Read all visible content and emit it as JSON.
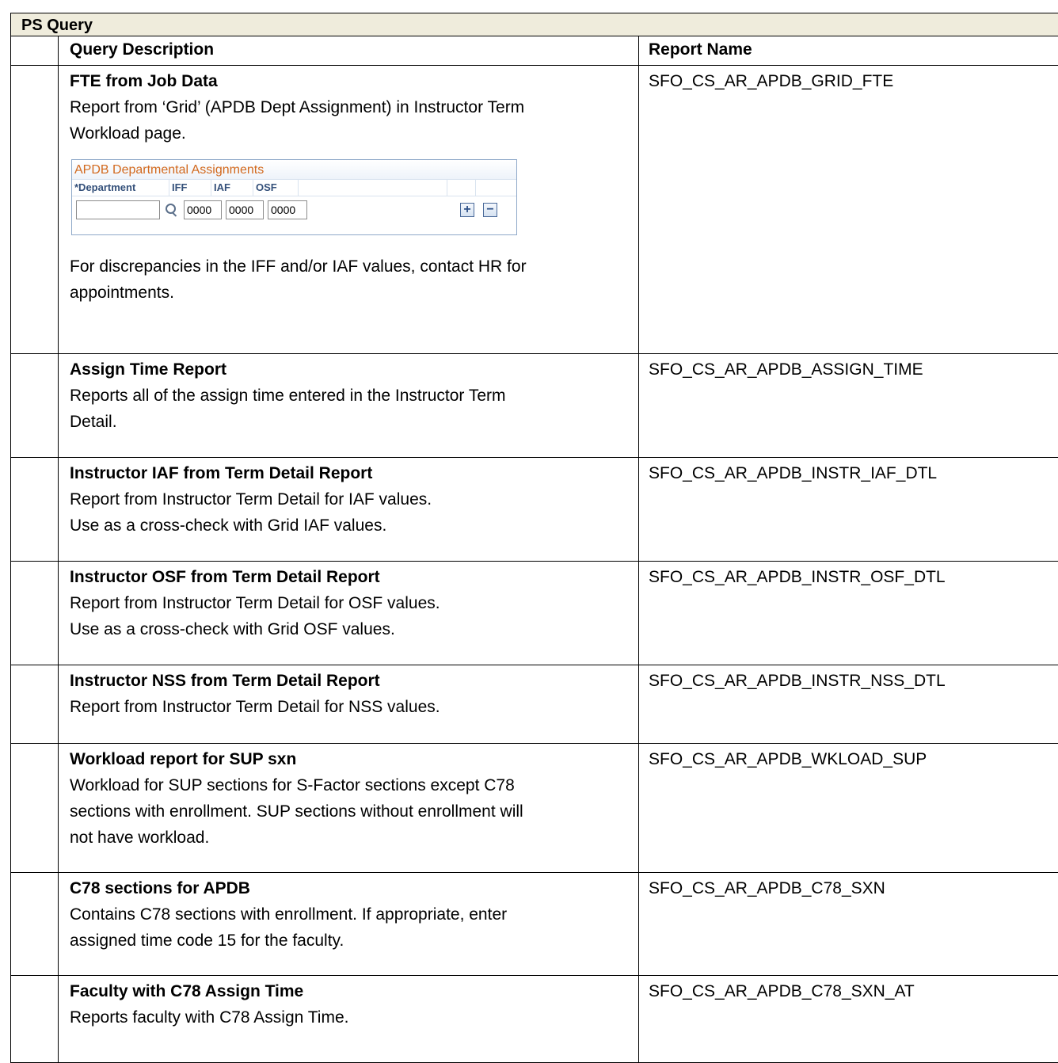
{
  "table": {
    "title": "PS Query",
    "headers": {
      "description": "Query Description",
      "report": "Report Name"
    },
    "rows": [
      {
        "title": "FTE from Job Data",
        "lines": [
          "Report from ‘Grid’ (APDB Dept Assignment) in Instructor Term",
          "Workload page."
        ],
        "after_lines": [
          "For discrepancies in the IFF and/or IAF values, contact HR for",
          "appointments."
        ],
        "report": "SFO_CS_AR_APDB_GRID_FTE"
      },
      {
        "title": "Assign Time Report",
        "lines": [
          "Reports all of the assign time entered in the Instructor Term",
          "Detail."
        ],
        "report": "SFO_CS_AR_APDB_ASSIGN_TIME"
      },
      {
        "title": "Instructor IAF from Term Detail Report",
        "lines": [
          "Report from Instructor Term Detail for IAF values.",
          "Use as a cross-check with Grid IAF values."
        ],
        "report": "SFO_CS_AR_APDB_INSTR_IAF_DTL"
      },
      {
        "title": "Instructor OSF from Term Detail Report",
        "lines": [
          "Report from Instructor Term Detail for OSF values.",
          "Use as a cross-check with Grid OSF values."
        ],
        "report": "SFO_CS_AR_APDB_INSTR_OSF_DTL"
      },
      {
        "title": "Instructor NSS from Term Detail Report",
        "lines": [
          "Report from Instructor Term Detail for NSS values."
        ],
        "report": "SFO_CS_AR_APDB_INSTR_NSS_DTL"
      },
      {
        "title": "Workload report for SUP sxn",
        "lines": [
          "Workload for SUP sections for S-Factor sections except C78",
          "sections with enrollment. SUP sections without enrollment will",
          "not have workload."
        ],
        "report": "SFO_CS_AR_APDB_WKLOAD_SUP"
      },
      {
        "title": "C78 sections for APDB",
        "lines": [
          "Contains C78 sections with enrollment.  If appropriate, enter",
          "assigned time code 15 for the faculty."
        ],
        "report": "SFO_CS_AR_APDB_C78_SXN"
      },
      {
        "title": "Faculty with C78 Assign Time",
        "lines": [
          "Reports faculty with C78 Assign Time."
        ],
        "report": "SFO_CS_AR_APDB_C78_SXN_AT"
      }
    ]
  },
  "apdb_grid": {
    "title": "APDB Departmental Assignments",
    "columns": [
      "*Department",
      "IFF",
      "IAF",
      "OSF"
    ],
    "department_value": "",
    "iff_value": "0000",
    "iaf_value": "0000",
    "osf_value": "0000",
    "add_label": "+",
    "remove_label": "−"
  }
}
